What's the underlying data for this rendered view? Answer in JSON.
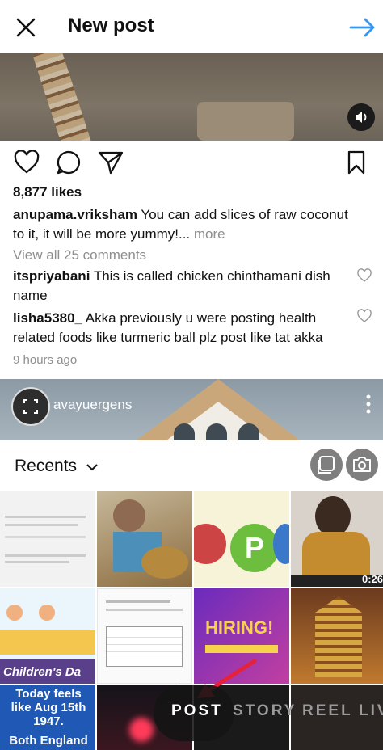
{
  "header": {
    "title": "New post",
    "accent_color": "#3797f0"
  },
  "post": {
    "likes": "8,877 likes",
    "caption_user": "anupama.vriksham",
    "caption_text": " You can add slices of raw coconut to it, it will be more yummy!...",
    "caption_more": " more",
    "view_all": "View all 25 comments",
    "comments": [
      {
        "user": "itspriyabani",
        "text": " This is called chicken chinthamani dish name"
      },
      {
        "user": "lisha5380_",
        "text": " Akka previously u were posting health related foods like turmeric ball plz post like tat akka"
      }
    ],
    "time_ago": "9 hours ago"
  },
  "next_post": {
    "username": "avayuergens"
  },
  "gallery": {
    "title": "Recents",
    "tiles": [
      {
        "label": ""
      },
      {
        "label": ""
      },
      {
        "label": "P"
      },
      {
        "label": "",
        "duration": "0:26"
      },
      {
        "label": "Children's Da"
      },
      {
        "label": ""
      },
      {
        "label": "HIRING!"
      },
      {
        "label": ""
      },
      {
        "label": "Today feels like Aug 15th 1947.",
        "sub": "Both England"
      },
      {
        "label": ""
      },
      {
        "label": ""
      },
      {
        "label": ""
      }
    ]
  },
  "modes": {
    "post": "POST",
    "story": "STORY",
    "reel": "REEL",
    "live": "LIV"
  }
}
